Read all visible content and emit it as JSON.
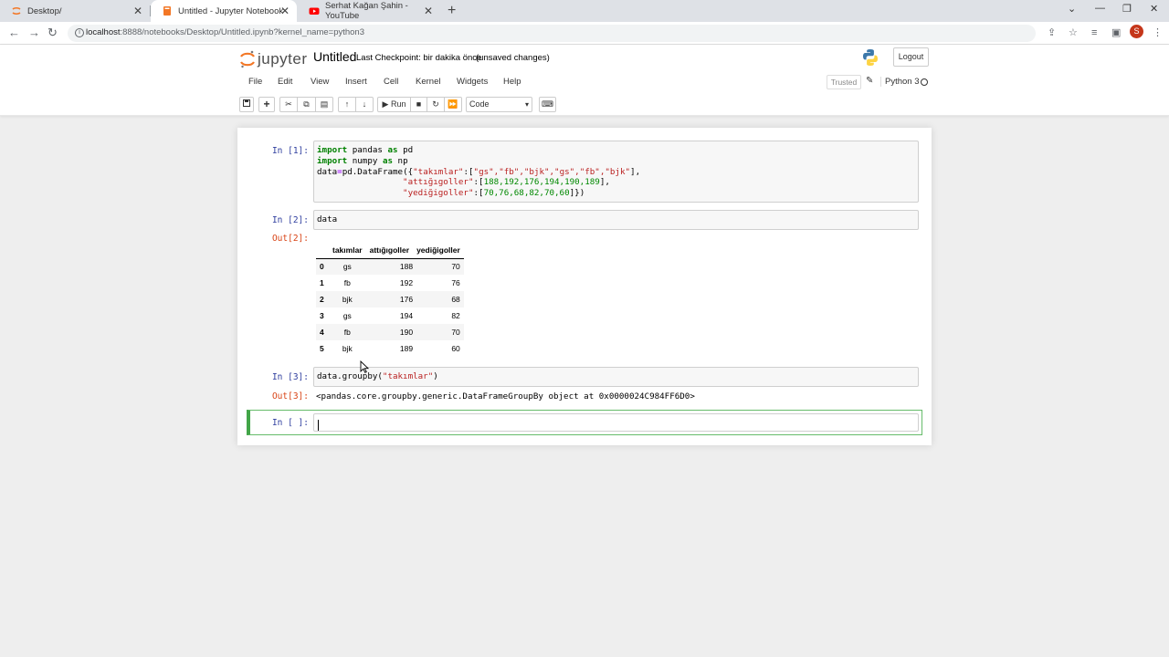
{
  "browser": {
    "tabs": [
      {
        "title": "Desktop/",
        "icon": "jupyter-icon"
      },
      {
        "title": "Untitled - Jupyter Notebook",
        "icon": "notebook-icon"
      },
      {
        "title": "Serhat Kağan Şahin - YouTube",
        "icon": "youtube-icon"
      }
    ],
    "new_tab": "+",
    "url_host": "localhost",
    "url_rest": ":8888/notebooks/Desktop/Untitled.ipynb?kernel_name=python3",
    "profile_initial": "S"
  },
  "jupyter": {
    "logo_text": "jupyter",
    "notebook_name": "Untitled",
    "checkpoint": "Last Checkpoint: bir dakika önce",
    "unsaved": "(unsaved changes)",
    "logout": "Logout",
    "menu": [
      "File",
      "Edit",
      "View",
      "Insert",
      "Cell",
      "Kernel",
      "Widgets",
      "Help"
    ],
    "trusted": "Trusted",
    "kernel_name": "Python 3",
    "run_label": "Run",
    "cell_type": "Code"
  },
  "cells": {
    "c1_prompt": "In [1]:",
    "c2_prompt": "In [2]:",
    "c2_code": "data",
    "c2_out_prompt": "Out[2]:",
    "c3_prompt": "In [3]:",
    "c3_out_prompt": "Out[3]:",
    "c3_output": "<pandas.core.groupby.generic.DataFrameGroupBy object at 0x0000024C984FF6D0>",
    "c4_prompt": "In [ ]:"
  },
  "dataframe": {
    "columns": [
      "takımlar",
      "attığıgoller",
      "yediğigoller"
    ],
    "rows": [
      {
        "index": "0",
        "takimlar": "gs",
        "atti": "188",
        "yedi": "70"
      },
      {
        "index": "1",
        "takimlar": "fb",
        "atti": "192",
        "yedi": "76"
      },
      {
        "index": "2",
        "takimlar": "bjk",
        "atti": "176",
        "yedi": "68"
      },
      {
        "index": "3",
        "takimlar": "gs",
        "atti": "194",
        "yedi": "82"
      },
      {
        "index": "4",
        "takimlar": "fb",
        "atti": "190",
        "yedi": "70"
      },
      {
        "index": "5",
        "takimlar": "bjk",
        "atti": "189",
        "yedi": "60"
      }
    ]
  },
  "code1": {
    "l1_import": "import",
    "l1_mod": " pandas ",
    "l1_as": "as",
    "l1_alias": " pd",
    "l2_import": "import",
    "l2_mod": " numpy ",
    "l2_as": "as",
    "l2_alias": " np",
    "l3_pre": "data",
    "l3_eq": "=",
    "l3_call": "pd.DataFrame({",
    "l3_key": "\"takımlar\"",
    "l3_colon": ":[",
    "l3_vals": "\"gs\",\"fb\",\"bjk\",\"gs\",\"fb\",\"bjk\"",
    "l3_end": "],",
    "l4_indent": "                 ",
    "l4_key": "\"attığıgoller\"",
    "l4_colon": ":[",
    "l4_vals": "188,192,176,194,190,189",
    "l4_end": "],",
    "l5_indent": "                 ",
    "l5_key": "\"yediğigoller\"",
    "l5_colon": ":[",
    "l5_vals": "70,76,68,82,70,60",
    "l5_end": "]})"
  },
  "code3": {
    "pre": "data.groupby(",
    "arg": "\"takımlar\"",
    "post": ")"
  }
}
